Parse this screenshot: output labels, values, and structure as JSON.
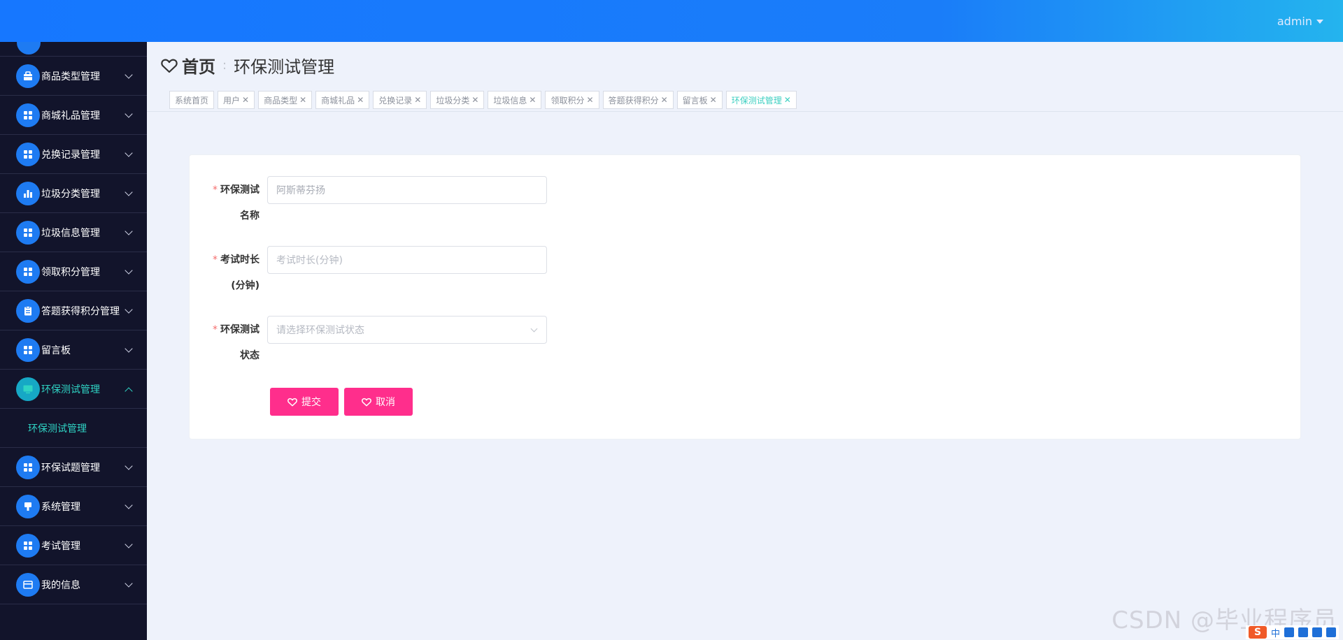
{
  "topbar": {
    "user": "admin"
  },
  "sidebar": {
    "items": [
      {
        "label": "商品类型管理",
        "icon": "briefcase-icon"
      },
      {
        "label": "商城礼品管理",
        "icon": "grid-icon"
      },
      {
        "label": "兑换记录管理",
        "icon": "grid-icon"
      },
      {
        "label": "垃圾分类管理",
        "icon": "bar-chart-icon"
      },
      {
        "label": "垃圾信息管理",
        "icon": "grid-icon"
      },
      {
        "label": "领取积分管理",
        "icon": "grid-icon"
      },
      {
        "label": "答题获得积分管理",
        "icon": "clipboard-icon"
      },
      {
        "label": "留言板",
        "icon": "grid-icon"
      },
      {
        "label": "环保测试管理",
        "icon": "monitor-icon"
      },
      {
        "label": "环保试题管理",
        "icon": "grid-icon"
      },
      {
        "label": "系统管理",
        "icon": "pin-icon"
      },
      {
        "label": "考试管理",
        "icon": "grid-icon"
      },
      {
        "label": "我的信息",
        "icon": "card-icon"
      }
    ],
    "submenu": {
      "label": "环保测试管理"
    }
  },
  "breadcrumb": {
    "home": "首页",
    "separator": ":",
    "current": "环保测试管理"
  },
  "tags": [
    {
      "label": "系统首页"
    },
    {
      "label": "用户"
    },
    {
      "label": "商品类型"
    },
    {
      "label": "商城礼品"
    },
    {
      "label": "兑换记录"
    },
    {
      "label": "垃圾分类"
    },
    {
      "label": "垃圾信息"
    },
    {
      "label": "领取积分"
    },
    {
      "label": "答题获得积分"
    },
    {
      "label": "留言板"
    },
    {
      "label": "环保测试管理"
    }
  ],
  "form": {
    "required_mark": "*",
    "name": {
      "label_line1": "环保测试",
      "label_line2": "名称",
      "value": "阿斯蒂芬扬"
    },
    "duration": {
      "label_line1": "考试时长",
      "label_line2": "(分钟)",
      "placeholder": "考试时长(分钟)"
    },
    "status": {
      "label_line1": "环保测试",
      "label_line2": "状态",
      "placeholder": "请选择环保测试状态"
    },
    "submit": "提交",
    "cancel": "取消"
  },
  "watermark": "CSDN @毕业程序员",
  "ime": {
    "lang": "中"
  },
  "colors": {
    "topbar": "#1677ff",
    "sidebar": "#12142b",
    "accent": "#2fd4c4",
    "button": "#ff2e8c"
  }
}
